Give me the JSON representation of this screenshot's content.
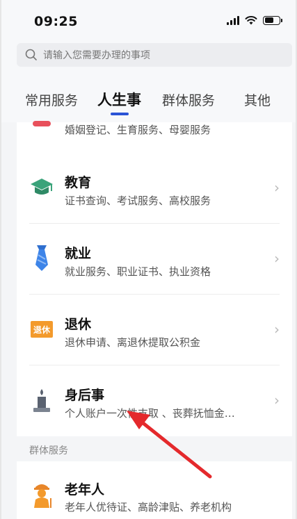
{
  "status": {
    "time": "09:25"
  },
  "search": {
    "placeholder": "请输入您需要办理的事项"
  },
  "tabs": [
    "常用服务",
    "人生事",
    "群体服务",
    "其他"
  ],
  "active_tab_index": 1,
  "items": [
    {
      "title": "",
      "desc": "婚姻登记、生育服务、母婴服务",
      "icon": "heart-icon"
    },
    {
      "title": "教育",
      "desc": "证书查询、考试服务、高校服务",
      "icon": "graduation-cap-icon"
    },
    {
      "title": "就业",
      "desc": "就业服务、职业证书、执业资格",
      "icon": "necktie-icon"
    },
    {
      "title": "退休",
      "desc": "退休申请、离退休提取公积金",
      "icon": "retirement-badge-icon",
      "icon_text": "退休"
    },
    {
      "title": "身后事",
      "desc": "个人账户一次性支取 、丧葬抚恤金…",
      "icon": "candle-icon"
    }
  ],
  "section": {
    "label": "群体服务"
  },
  "group_items": [
    {
      "title": "老年人",
      "desc": "老年人优待证、高龄津贴、养老机构",
      "icon": "elderly-person-icon"
    }
  ],
  "colors": {
    "accent": "#2a53d6",
    "education": "#3aa37a",
    "employment": "#3d84e8",
    "retirement": "#f39a2c",
    "funeral": "#5a6270",
    "elderly": "#f39a2c",
    "marriage": "#e8505b",
    "arrow": "#e4292c"
  }
}
